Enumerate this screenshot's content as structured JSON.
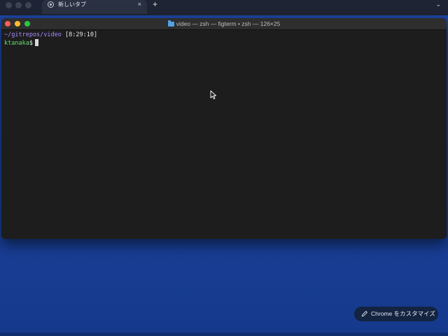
{
  "chrome": {
    "tab_title": "新しいタブ",
    "tab_close": "×",
    "new_tab": "+",
    "tab_menu": "⌄",
    "customize_label": "Chrome をカスタマイズ"
  },
  "terminal": {
    "window_title": "video — zsh — figterm • zsh — 126×25",
    "prompt_path": "~/gitrepos/video",
    "prompt_time": "[8:29:10]",
    "prompt_user": "ktanaka",
    "prompt_symbol": "$"
  },
  "colors": {
    "desktop_bg": "#1d46a3",
    "terminal_bg": "#1d1d1d",
    "path": "#a68aff",
    "user": "#62e06a",
    "close": "#fe5f57",
    "minimize": "#febc2e",
    "maximize": "#28c840"
  }
}
